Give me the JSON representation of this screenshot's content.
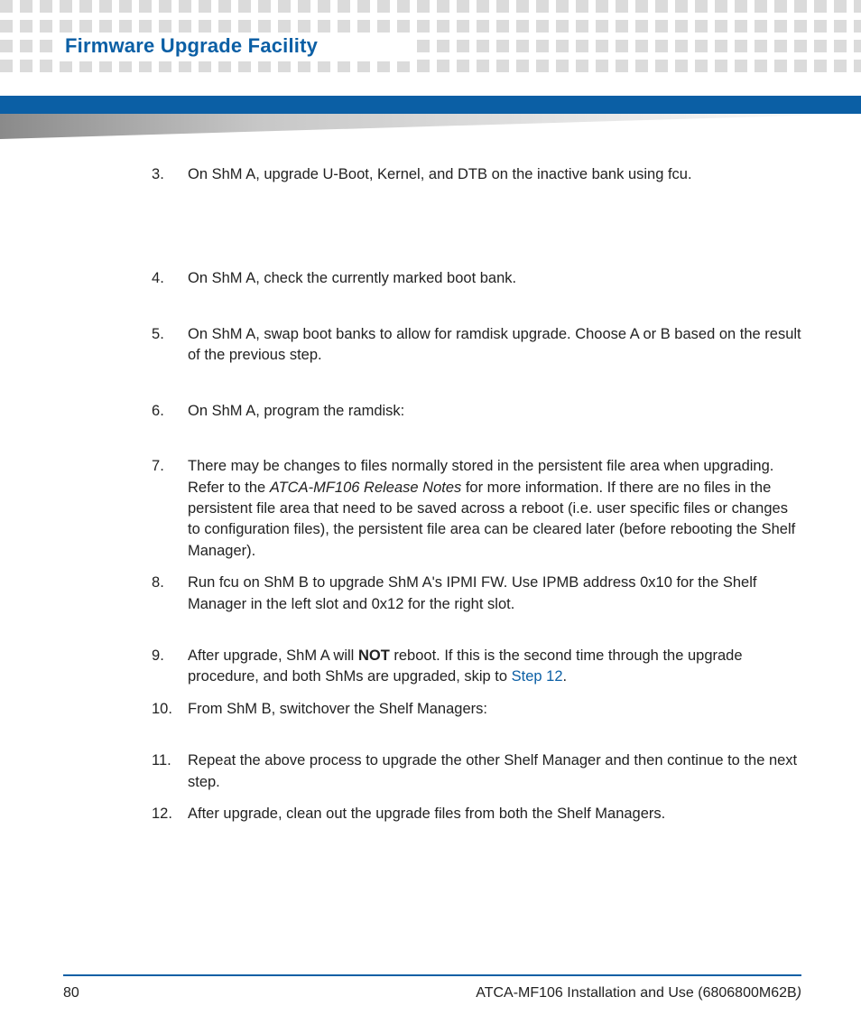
{
  "header": {
    "section_title": "Firmware Upgrade Facility"
  },
  "steps": {
    "s3": "On ShM A, upgrade U-Boot, Kernel, and DTB on the inactive bank using fcu.",
    "s4": "On ShM A, check the currently marked boot bank.",
    "s5": "On ShM A, swap boot banks to allow for ramdisk upgrade. Choose A or B based on the result of the previous step.",
    "s6": "On ShM A, program the ramdisk:",
    "s7_a": "There may be changes to files normally stored in the persistent file area when upgrading. Refer to the ",
    "s7_em": "ATCA-MF106 Release Notes",
    "s7_b": " for more information. If there are no files in the persistent file area that need to be saved across a reboot (i.e. user specific files or changes to configuration files), the persistent file area can be cleared later (before rebooting the Shelf Manager).",
    "s8": "Run fcu on ShM B to upgrade ShM A's IPMI FW.  Use IPMB address 0x10 for the Shelf Manager in the left slot and 0x12 for the right slot.",
    "s9_a": "After upgrade, ShM A will ",
    "s9_bold": "NOT",
    "s9_b": " reboot. If this is the second time through the upgrade procedure, and both ShMs are upgraded, skip to ",
    "s9_link": "Step 12",
    "s9_c": ".",
    "s10": "From ShM B, switchover the Shelf Managers:",
    "s11": "Repeat the above process to upgrade the other Shelf Manager and then continue to the next step.",
    "s12": "After upgrade, clean out the upgrade files from both the Shelf Managers."
  },
  "footer": {
    "page_number": "80",
    "doc_title_prefix": "ATCA-MF106 Installation and Use (6806800M62B",
    "doc_title_suffix": ")"
  }
}
